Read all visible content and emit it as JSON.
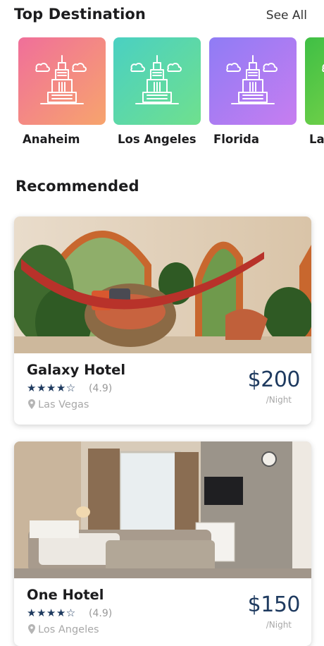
{
  "top_destination": {
    "title": "Top Destination",
    "see_all": "See All",
    "items": [
      {
        "name": "Anaheim",
        "icon": "city-building-icon",
        "gradient": [
          "#f06f9a",
          "#f7a46d"
        ]
      },
      {
        "name": "Los Angeles",
        "icon": "city-building-icon",
        "gradient": [
          "#4ad0c2",
          "#6fe08e"
        ]
      },
      {
        "name": "Florida",
        "icon": "city-building-icon",
        "gradient": [
          "#8f7cf5",
          "#c77df0"
        ]
      },
      {
        "name": "La",
        "icon": "city-building-icon",
        "gradient": [
          "#3fbf45",
          "#88d84a"
        ]
      }
    ]
  },
  "recommended": {
    "title": "Recommended",
    "hotels": [
      {
        "name": "Galaxy Hotel",
        "stars": "★★★★☆",
        "rating": "(4.9)",
        "location": "Las Vegas",
        "price": "$200",
        "per": "/Night"
      },
      {
        "name": "One Hotel",
        "stars": "★★★★☆",
        "rating": "(4.9)",
        "location": "Los Angeles",
        "price": "$150",
        "per": "/Night"
      }
    ]
  },
  "colors": {
    "accent": "#1e3a5f",
    "muted": "#a8a8a8"
  }
}
